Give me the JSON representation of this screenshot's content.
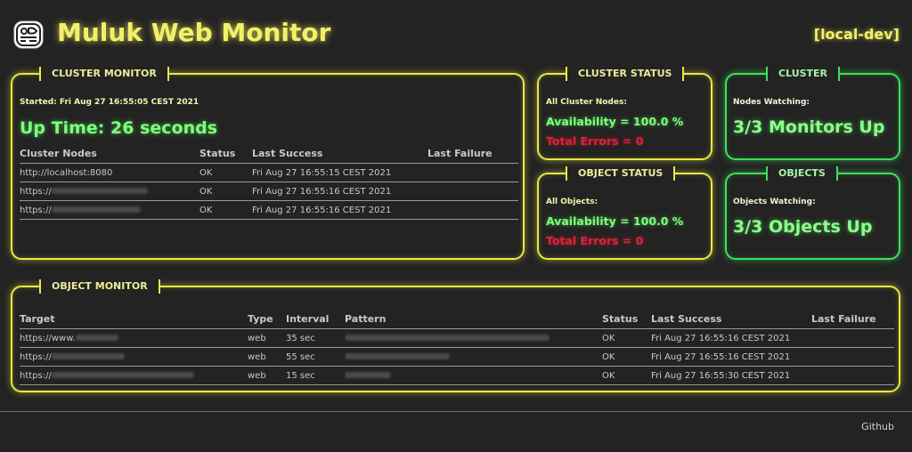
{
  "header": {
    "title": "Muluk Web Monitor",
    "environment": "[local-dev]",
    "logo_icon": "maya-glyph-icon"
  },
  "cluster_monitor": {
    "legend": "CLUSTER MONITOR",
    "started": "Started: Fri Aug 27 16:55:05 CEST 2021",
    "uptime": "Up Time: 26 seconds",
    "columns": [
      "Cluster Nodes",
      "Status",
      "Last Success",
      "Last Failure"
    ],
    "rows": [
      {
        "node": "http://localhost:8080",
        "status": "OK",
        "last_success": "Fri Aug 27 16:55:15 CEST 2021",
        "last_failure": ""
      },
      {
        "node": "https://",
        "status": "OK",
        "last_success": "Fri Aug 27 16:55:16 CEST 2021",
        "last_failure": ""
      },
      {
        "node": "https://",
        "status": "OK",
        "last_success": "Fri Aug 27 16:55:16 CEST 2021",
        "last_failure": ""
      }
    ]
  },
  "cluster_status": {
    "legend": "CLUSTER STATUS",
    "label": "All Cluster Nodes:",
    "availability": "Availability = 100.0 %",
    "errors": "Total Errors = 0"
  },
  "object_status": {
    "legend": "OBJECT STATUS",
    "label": "All Objects:",
    "availability": "Availability = 100.0 %",
    "errors": "Total Errors = 0"
  },
  "cluster": {
    "legend": "CLUSTER",
    "label": "Nodes Watching:",
    "value": "3/3 Monitors Up"
  },
  "objects": {
    "legend": "OBJECTS",
    "label": "Objects Watching:",
    "value": "3/3 Objects Up"
  },
  "object_monitor": {
    "legend": "OBJECT MONITOR",
    "columns": [
      "Target",
      "Type",
      "Interval",
      "Pattern",
      "Status",
      "Last Success",
      "Last Failure"
    ],
    "rows": [
      {
        "target": "https://www.",
        "type": "web",
        "interval": "35 sec",
        "pattern": "",
        "status": "OK",
        "last_success": "Fri Aug 27 16:55:16 CEST 2021",
        "last_failure": ""
      },
      {
        "target": "https://",
        "type": "web",
        "interval": "55 sec",
        "pattern": "",
        "status": "OK",
        "last_success": "Fri Aug 27 16:55:16 CEST 2021",
        "last_failure": ""
      },
      {
        "target": "https://",
        "type": "web",
        "interval": "15 sec",
        "pattern": "",
        "status": "OK",
        "last_success": "Fri Aug 27 16:55:30 CEST 2021",
        "last_failure": ""
      }
    ]
  },
  "footer": {
    "github_label": "Github"
  },
  "colors": {
    "background": "#232323",
    "yellow_neon": "#e8e845",
    "green_neon": "#3fe05a",
    "availability_green": "#7dff7d",
    "error_red": "#e0203a"
  }
}
